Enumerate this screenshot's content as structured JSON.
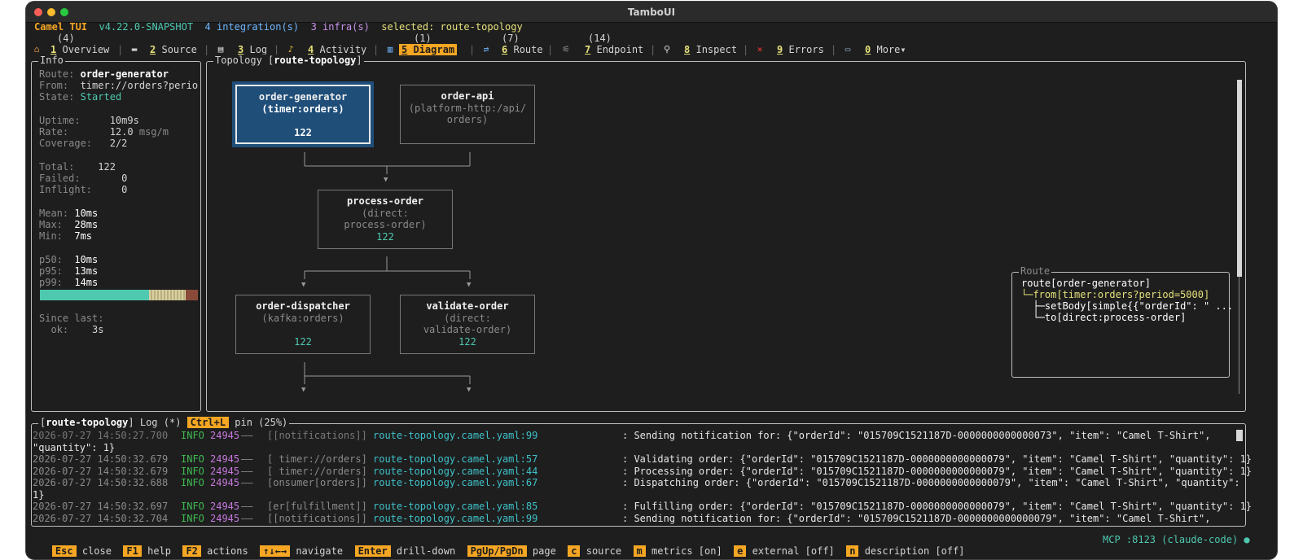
{
  "window": {
    "title": "TamboUI"
  },
  "status": {
    "app": "Camel TUI",
    "version": "v4.22.0-SNAPSHOT",
    "integrations": "4 integration(s)",
    "infra": "3 infra(s)",
    "selected": "selected: route-topology"
  },
  "tabs": [
    {
      "num": "1",
      "label": "Overview",
      "count": "(4)",
      "icon": "home-icon"
    },
    {
      "num": "2",
      "label": "Source",
      "count": "",
      "icon": "laptop-icon"
    },
    {
      "num": "3",
      "label": "Log",
      "count": "",
      "icon": "document-icon"
    },
    {
      "num": "4",
      "label": "Activity",
      "count": "",
      "icon": "bell-icon"
    },
    {
      "num": "5",
      "label": "Diagram",
      "count": "(1)",
      "icon": "chart-icon"
    },
    {
      "num": "6",
      "label": "Route",
      "count": "(7)",
      "icon": "route-icon"
    },
    {
      "num": "7",
      "label": "Endpoint",
      "count": "(14)",
      "icon": "plug-icon"
    },
    {
      "num": "8",
      "label": "Inspect",
      "count": "",
      "icon": "magnifier-icon"
    },
    {
      "num": "9",
      "label": "Errors",
      "count": "",
      "icon": "cross-icon"
    },
    {
      "num": "0",
      "label": "More▾",
      "count": "",
      "icon": "folder-icon"
    }
  ],
  "info": {
    "title": "Info",
    "route_label": "Route:",
    "route_value": "order-generator",
    "from_label": "From:",
    "from_value": "timer://orders?perio",
    "state_label": "State:",
    "state_value": "Started",
    "uptime_label": "Uptime:",
    "uptime_value": "10m9s",
    "rate_label": "Rate:",
    "rate_value": "12.0",
    "rate_unit": "msg/m",
    "coverage_label": "Coverage:",
    "coverage_value": "2/2",
    "total_label": "Total:",
    "total_value": "122",
    "failed_label": "Failed:",
    "failed_value": "0",
    "inflight_label": "Inflight:",
    "inflight_value": "0",
    "mean_label": "Mean:",
    "mean_value": "10ms",
    "max_label": "Max:",
    "max_value": "28ms",
    "min_label": "Min:",
    "min_value": "7ms",
    "p50_label": "p50:",
    "p50_value": "10ms",
    "p95_label": "p95:",
    "p95_value": "13ms",
    "p99_label": "p99:",
    "p99_value": "14ms",
    "since_label": "Since last:",
    "ok_label": "ok:",
    "ok_value": "3s"
  },
  "topology": {
    "title_prefix": "Topology [",
    "title_name": "route-topology",
    "title_suffix": "]",
    "nodes": [
      {
        "name": "order-generator",
        "uri": "(timer:orders)",
        "count": "122",
        "selected": true
      },
      {
        "name": "order-api",
        "uri": "(platform-http:/api/",
        "uri2": "orders)",
        "count": ""
      },
      {
        "name": "process-order",
        "uri": "(direct:",
        "uri2": "process-order)",
        "count": "122"
      },
      {
        "name": "order-dispatcher",
        "uri": "(kafka:orders)",
        "count": "122"
      },
      {
        "name": "validate-order",
        "uri": "(direct:",
        "uri2": "validate-order)",
        "count": "122"
      }
    ]
  },
  "route_panel": {
    "title": "Route",
    "lines": [
      "route[order-generator]",
      "└─from[timer:orders?period=5000]",
      "  ├─setBody[simple{{\"orderId\": \" ...",
      "  └─to[direct:process-order]"
    ]
  },
  "log": {
    "title_name": "route-topology",
    "title_mid": " Log (*) ",
    "pin_key": "Ctrl+L",
    "pin_text": " pin (25%)",
    "lines": [
      {
        "ts": "2026-07-27 14:50:27.700",
        "level": "INFO",
        "pid": "24945",
        "dash": "——",
        "thread": "[[notifications]]",
        "src": "route-topology.camel.yaml:99",
        "msg": ": Sending notification for: {\"orderId\": \"015709C1521187D-0000000000000073\", \"item\": \"Camel T-Shirt\",",
        "dimmed": true
      },
      {
        "ts": "",
        "msg_wrap": "\"quantity\": 1}"
      },
      {
        "ts": "2026-07-27 14:50:32.679",
        "level": "INFO",
        "pid": "24945",
        "dash": "——",
        "thread": "[ timer://orders]",
        "src": "route-topology.camel.yaml:57",
        "msg": ": Validating order: {\"orderId\": \"015709C1521187D-0000000000000079\", \"item\": \"Camel T-Shirt\", \"quantity\": 1}"
      },
      {
        "ts": "2026-07-27 14:50:32.679",
        "level": "INFO",
        "pid": "24945",
        "dash": "——",
        "thread": "[ timer://orders]",
        "src": "route-topology.camel.yaml:44",
        "msg": ": Processing order: {\"orderId\": \"015709C1521187D-0000000000000079\", \"item\": \"Camel T-Shirt\", \"quantity\": 1}"
      },
      {
        "ts": "2026-07-27 14:50:32.688",
        "level": "INFO",
        "pid": "24945",
        "dash": "——",
        "thread": "[onsumer[orders]]",
        "src": "route-topology.camel.yaml:67",
        "msg": ": Dispatching order: {\"orderId\": \"015709C1521187D-0000000000000079\", \"item\": \"Camel T-Shirt\", \"quantity\":"
      },
      {
        "ts": "",
        "msg_wrap": "1}"
      },
      {
        "ts": "2026-07-27 14:50:32.697",
        "level": "INFO",
        "pid": "24945",
        "dash": "——",
        "thread": "[er[fulfillment]]",
        "src": "route-topology.camel.yaml:85",
        "msg": ": Fulfilling order: {\"orderId\": \"015709C1521187D-0000000000000079\", \"item\": \"Camel T-Shirt\", \"quantity\": 1}"
      },
      {
        "ts": "2026-07-27 14:50:32.704",
        "level": "INFO",
        "pid": "24945",
        "dash": "——",
        "thread": "[[notifications]]",
        "src": "route-topology.camel.yaml:99",
        "msg": ": Sending notification for: {\"orderId\": \"015709C1521187D-0000000000000079\", \"item\": \"Camel T-Shirt\","
      }
    ]
  },
  "footer": {
    "keys": [
      {
        "key": "Esc",
        "label": "close"
      },
      {
        "key": "F1",
        "label": "help"
      },
      {
        "key": "F2",
        "label": "actions"
      },
      {
        "key": "↑↓←→",
        "label": "navigate"
      },
      {
        "key": "Enter",
        "label": "drill-down"
      },
      {
        "key": "PgUp/PgDn",
        "label": "page"
      },
      {
        "key": "c",
        "label": "source"
      },
      {
        "key": "m",
        "label": "metrics [on]"
      },
      {
        "key": "e",
        "label": "external [off]"
      },
      {
        "key": "n",
        "label": "description [off]"
      }
    ],
    "mcp": "MCP :8123 (claude-code)"
  },
  "colors": {
    "accent": "#f5a623",
    "selected_node": "#1f4e79",
    "count": "#4ec9b0",
    "state_ok": "#4ec9b0"
  },
  "latency_bar": {
    "p50_fraction": 0.69,
    "p95_fraction": 0.23,
    "p99_fraction": 0.08
  }
}
